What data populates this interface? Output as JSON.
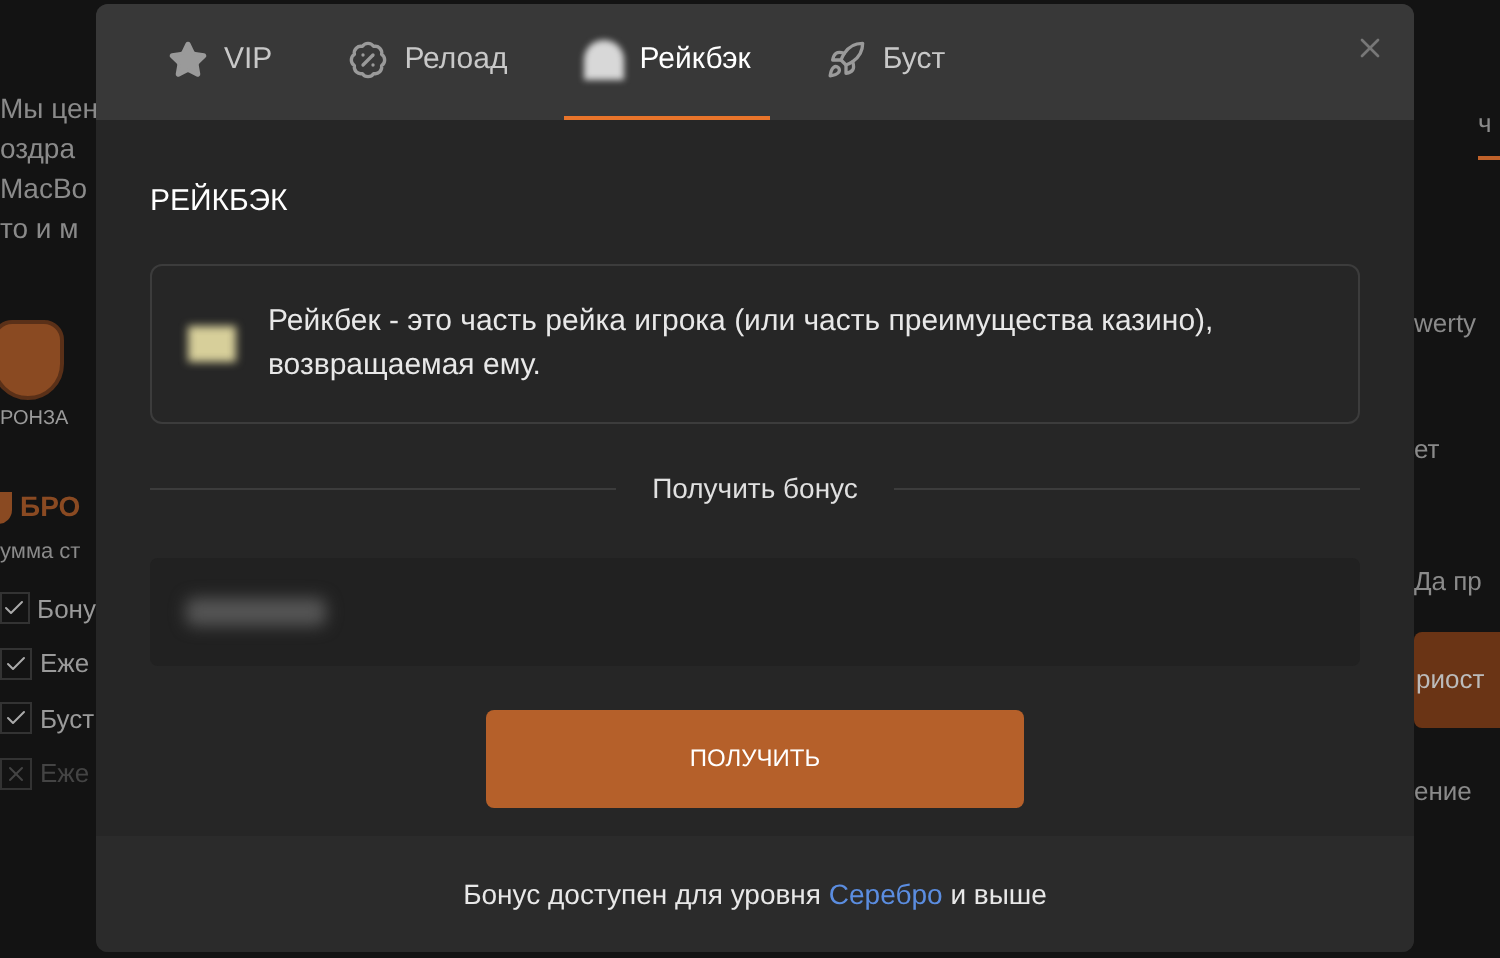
{
  "background": {
    "left": {
      "intro_lines": [
        "Мы цен",
        "оздра",
        "MacBo",
        "то и м"
      ],
      "badge_label": "РОНЗА",
      "level_title": "БРО",
      "sum_label": "умма ст",
      "perks": [
        {
          "label": "Бону",
          "checked": true
        },
        {
          "label": "Еже",
          "checked": true
        },
        {
          "label": "Буст",
          "checked": true
        },
        {
          "label": "Еже",
          "checked": false
        }
      ]
    },
    "right": {
      "tab": "ч",
      "name": "werty",
      "line_1": "ет",
      "line_2": "Да пр",
      "button": "риост",
      "line_3": "ение"
    }
  },
  "modal": {
    "tabs": [
      {
        "label": "VIP",
        "kind": "star",
        "selected": false
      },
      {
        "label": "Релоад",
        "kind": "percent",
        "selected": false
      },
      {
        "label": "Рейкбэк",
        "kind": "bag",
        "selected": true
      },
      {
        "label": "Буст",
        "kind": "rocket",
        "selected": false
      }
    ],
    "title": "РЕЙКБЭК",
    "info": "Рейкбек - это часть рейка игрока (или часть преимущества казино), возвращаемая ему.",
    "divider_label": "Получить бонус",
    "button": "ПОЛУЧИТЬ",
    "footer": {
      "before": "Бонус доступен для уровня",
      "level_link": "Серебро",
      "after": "и выше"
    }
  }
}
